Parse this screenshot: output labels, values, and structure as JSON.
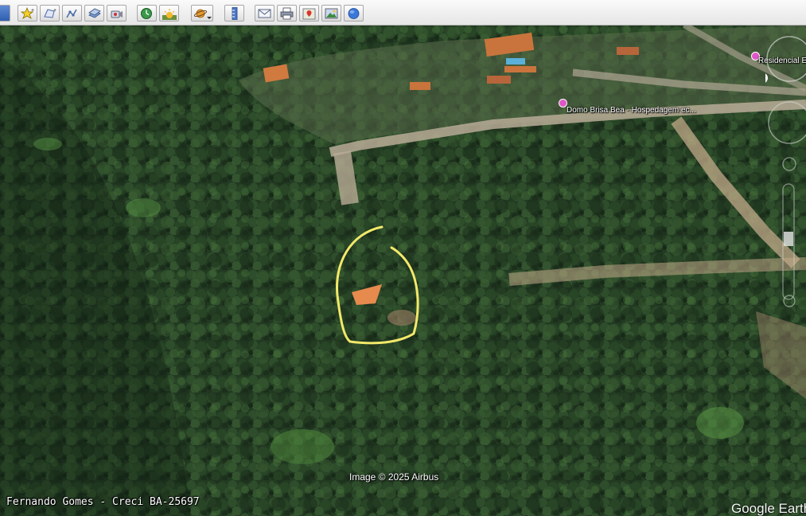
{
  "toolbar": {
    "buttons": [
      {
        "name": "sidebar-toggle-button",
        "icon": "sidebar-icon"
      },
      {
        "name": "add-placemark-button",
        "icon": "placemark-star-icon"
      },
      {
        "name": "add-polygon-button",
        "icon": "polygon-icon"
      },
      {
        "name": "add-path-button",
        "icon": "path-icon"
      },
      {
        "name": "add-image-overlay-button",
        "icon": "image-overlay-icon"
      },
      {
        "name": "record-tour-button",
        "icon": "record-tour-icon"
      },
      {
        "name": "historical-imagery-button",
        "icon": "clock-icon"
      },
      {
        "name": "sunlight-button",
        "icon": "sun-icon"
      },
      {
        "name": "switch-planet-button",
        "icon": "planet-icon"
      },
      {
        "name": "ruler-button",
        "icon": "ruler-icon"
      },
      {
        "name": "email-button",
        "icon": "envelope-icon"
      },
      {
        "name": "print-button",
        "icon": "printer-icon"
      },
      {
        "name": "view-in-maps-button",
        "icon": "map-pin-icon"
      },
      {
        "name": "save-image-button",
        "icon": "photo-icon"
      },
      {
        "name": "earth-button",
        "icon": "globe-icon"
      }
    ]
  },
  "map": {
    "places": [
      {
        "label": "Domo Brisa Bea - Hospedagem ec...",
        "icon": "lodging-pin-icon"
      },
      {
        "label": "Residencial Es",
        "icon": "lodging-pin-icon"
      }
    ],
    "credit": "Image © 2025 Airbus",
    "watermark": "Fernando Gomes - Creci BA-25697",
    "logo": "Google Earth",
    "annotation": {
      "shape": "yellow hand-drawn loop",
      "color": "#f2e96a"
    }
  },
  "colors": {
    "forest_dark": "#1d3320",
    "forest_mid": "#2c4a2a",
    "road": "#b9ab96",
    "roof": "#d07a40",
    "highlight": "#f2e96a"
  }
}
